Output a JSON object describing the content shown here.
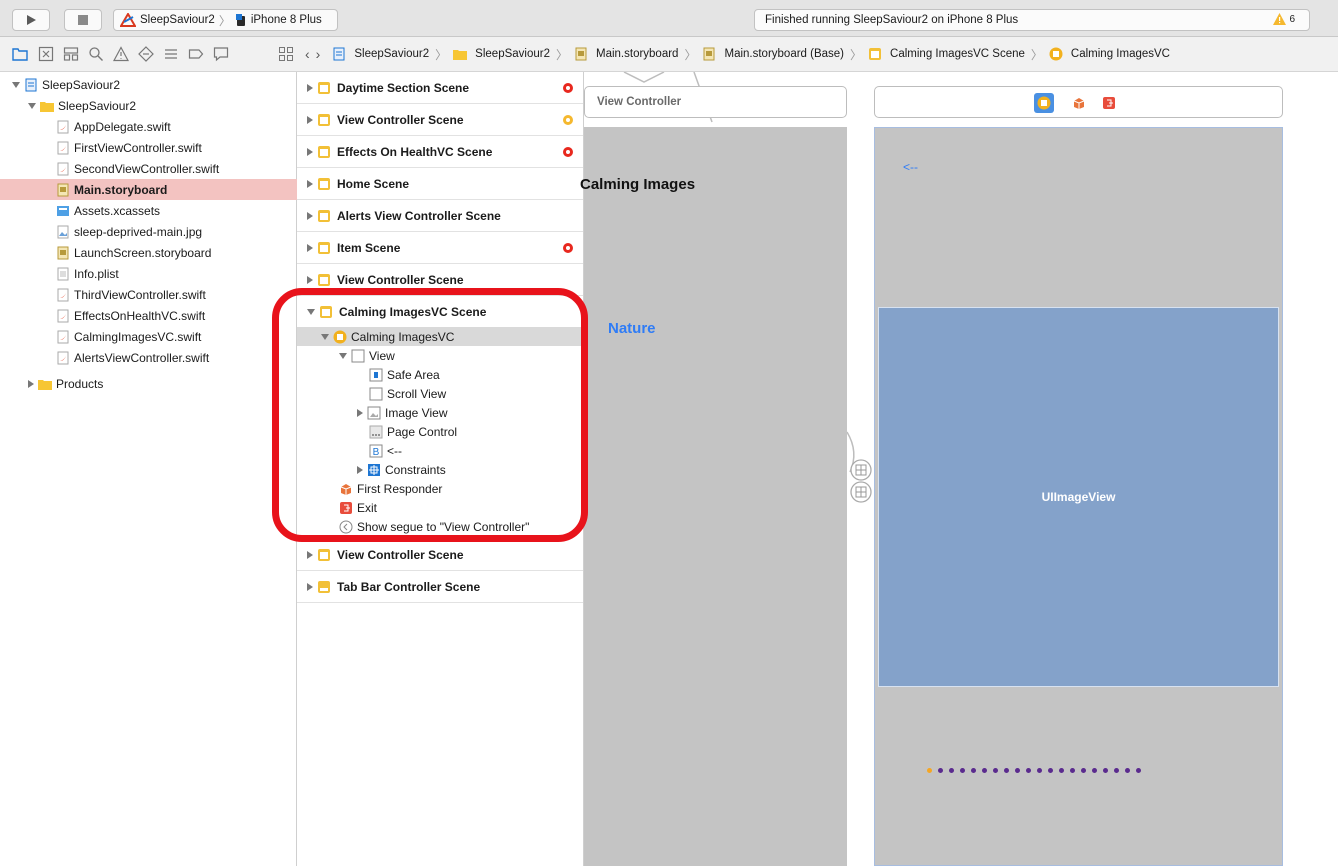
{
  "toolbar": {
    "scheme_project": "SleepSaviour2",
    "scheme_device": "iPhone 8 Plus",
    "status_text": "Finished running SleepSaviour2 on iPhone 8 Plus",
    "warning_count": "6"
  },
  "breadcrumb": [
    {
      "label": "SleepSaviour2",
      "icon": "project-icon"
    },
    {
      "label": "SleepSaviour2",
      "icon": "folder-icon"
    },
    {
      "label": "Main.storyboard",
      "icon": "storyboard-icon"
    },
    {
      "label": "Main.storyboard (Base)",
      "icon": "storyboard-icon"
    },
    {
      "label": "Calming ImagesVC Scene",
      "icon": "scene-icon"
    },
    {
      "label": "Calming ImagesVC",
      "icon": "viewcontroller-icon"
    }
  ],
  "navigator": {
    "project": "SleepSaviour2",
    "group": "SleepSaviour2",
    "files": [
      {
        "label": "AppDelegate.swift",
        "icon": "swift-file-icon"
      },
      {
        "label": "FirstViewController.swift",
        "icon": "swift-file-icon"
      },
      {
        "label": "SecondViewController.swift",
        "icon": "swift-file-icon"
      },
      {
        "label": "Main.storyboard",
        "icon": "storyboard-icon",
        "selected": true
      },
      {
        "label": "Assets.xcassets",
        "icon": "assets-icon"
      },
      {
        "label": "sleep-deprived-main.jpg",
        "icon": "image-file-icon"
      },
      {
        "label": "LaunchScreen.storyboard",
        "icon": "storyboard-icon"
      },
      {
        "label": "Info.plist",
        "icon": "plist-icon"
      },
      {
        "label": "ThirdViewController.swift",
        "icon": "swift-file-icon"
      },
      {
        "label": "EffectsOnHealthVC.swift",
        "icon": "swift-file-icon"
      },
      {
        "label": "CalmingImagesVC.swift",
        "icon": "swift-file-icon"
      },
      {
        "label": "AlertsViewController.swift",
        "icon": "swift-file-icon"
      }
    ],
    "products": "Products"
  },
  "outline": {
    "scenes_top": [
      {
        "label": "Daytime Section Scene",
        "status": "error"
      },
      {
        "label": "View Controller Scene",
        "status": "warning"
      },
      {
        "label": "Effects On HealthVC Scene",
        "status": "error"
      },
      {
        "label": "Home Scene",
        "status": "none"
      },
      {
        "label": "Alerts View Controller Scene",
        "status": "none"
      },
      {
        "label": "Item Scene",
        "status": "error"
      },
      {
        "label": "View Controller Scene",
        "status": "none"
      }
    ],
    "expanded_scene": "Calming ImagesVC Scene",
    "vc": "Calming ImagesVC",
    "view": "View",
    "children": [
      "Safe Area",
      "Scroll View",
      "Image View",
      "Page Control",
      "<--",
      "Constraints"
    ],
    "first_responder": "First Responder",
    "exit": "Exit",
    "segue": "Show segue to \"View Controller\"",
    "scenes_bottom": [
      "View Controller Scene",
      "Tab Bar Controller Scene"
    ]
  },
  "canvas": {
    "left_title": "View Controller",
    "left_heading": "Calming Images",
    "left_link": "Nature",
    "back_label": "<--",
    "image_view_label": "UIImageView",
    "page_control": {
      "pages": 20,
      "current_page": 1
    }
  },
  "colors": {
    "highlight": "#e8131b",
    "selection": "#f3c3c1",
    "error": "#e8281e",
    "warning": "#f5b82e",
    "image_view": "#84a2ca",
    "link": "#2f7cf6"
  }
}
